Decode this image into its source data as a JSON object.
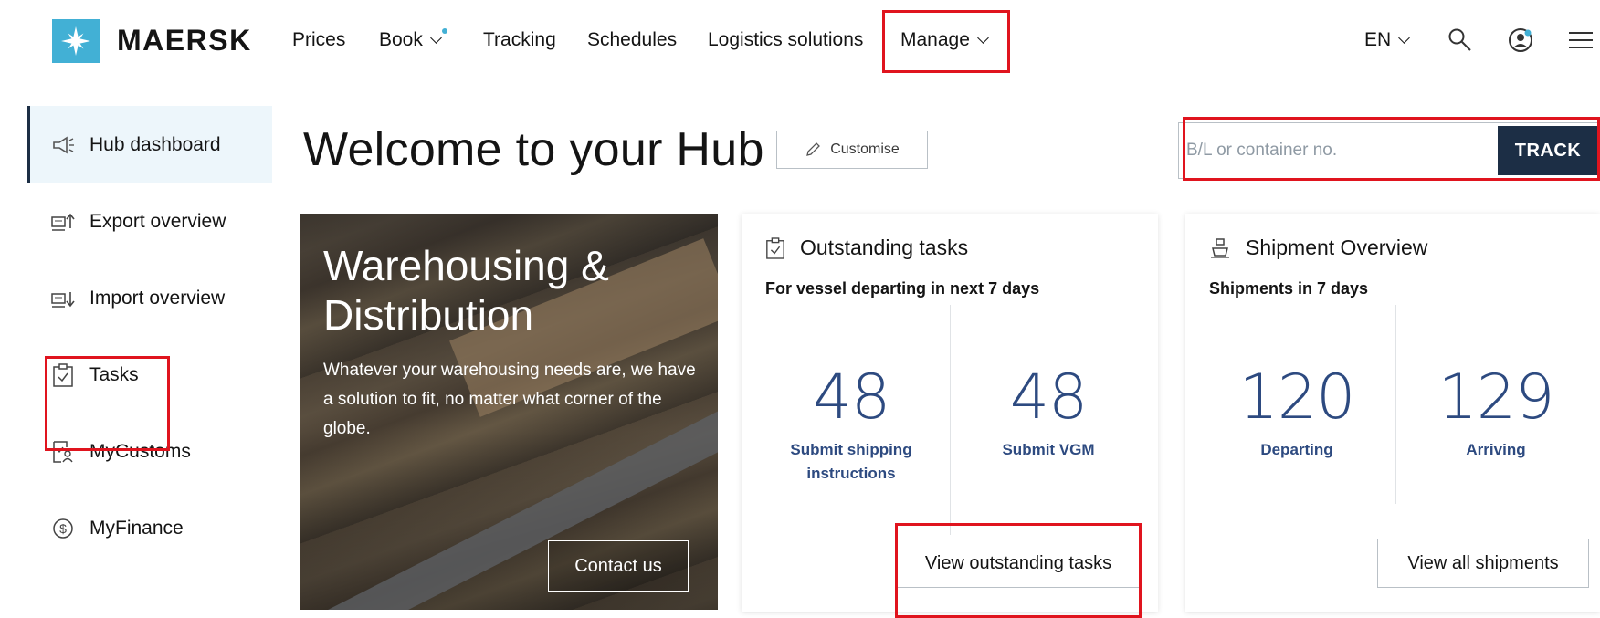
{
  "brand": {
    "name": "MAERSK",
    "logo_icon": "star-icon",
    "logo_color": "#42b0d5"
  },
  "nav": {
    "prices": "Prices",
    "book": "Book",
    "tracking": "Tracking",
    "schedules": "Schedules",
    "logistics": "Logistics solutions",
    "manage": "Manage",
    "language": "EN"
  },
  "sidebar": {
    "items": [
      {
        "label": "Hub dashboard",
        "icon": "megaphone-icon",
        "active": true
      },
      {
        "label": "Export overview",
        "icon": "export-icon"
      },
      {
        "label": "Import overview",
        "icon": "import-icon"
      },
      {
        "label": "Tasks",
        "icon": "clipboard-check-icon"
      },
      {
        "label": "MyCustoms",
        "icon": "customs-icon"
      },
      {
        "label": "MyFinance",
        "icon": "dollar-icon"
      }
    ]
  },
  "main": {
    "welcome": "Welcome to your Hub",
    "customise": "Customise",
    "track": {
      "placeholder": "B/L or container no.",
      "button": "TRACK"
    }
  },
  "promo": {
    "title": "Warehousing & Distribution",
    "text": "Whatever your warehousing needs are, we have a solution to fit, no matter what corner of the globe.",
    "button": "Contact us"
  },
  "tasks_card": {
    "title": "Outstanding tasks",
    "subtitle": "For vessel departing in next 7 days",
    "stats": [
      {
        "value": "48",
        "label": "Submit shipping instructions"
      },
      {
        "value": "48",
        "label": "Submit VGM"
      }
    ],
    "button": "View outstanding tasks"
  },
  "shipment_card": {
    "title": "Shipment Overview",
    "subtitle": "Shipments in 7 days",
    "stats": [
      {
        "value": "120",
        "label": "Departing"
      },
      {
        "value": "129",
        "label": "Arriving"
      }
    ],
    "button": "View all shipments"
  },
  "colors": {
    "accent_dark": "#1c2e45",
    "stat_blue": "#2d4a80",
    "highlight_red": "#e0141e",
    "brand_blue": "#42b0d5"
  }
}
